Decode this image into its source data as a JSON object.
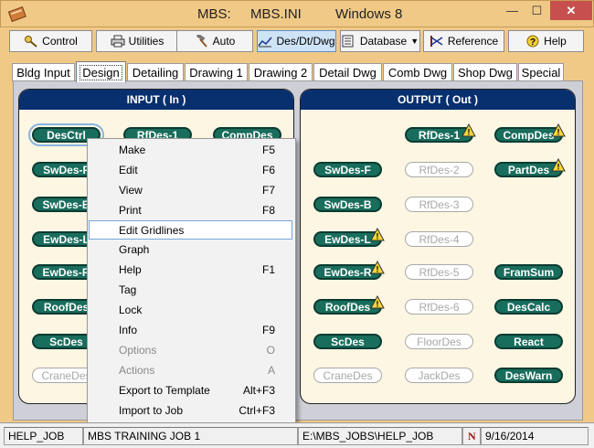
{
  "window": {
    "title_app": "MBS:",
    "title_file": "MBS.INI",
    "title_os": "Windows 8",
    "minimize": "—",
    "maximize": "☐",
    "close": "✕"
  },
  "toolbar": {
    "control": "Control",
    "utilities": "Utilities",
    "auto": "Auto",
    "desdtdwg": "Des/Dt/Dwg",
    "database": "Database",
    "reference": "Reference",
    "help": "Help"
  },
  "tabs": [
    "Bldg Input",
    "Design",
    "Detailing",
    "Drawing 1",
    "Drawing 2",
    "Detail Dwg",
    "Comb Dwg",
    "Shop Dwg",
    "Special"
  ],
  "input_panel": {
    "header": "INPUT ( In )",
    "pills": [
      "DesCtrl",
      "RfDes-1",
      "CompDes",
      "SwDes-F",
      "SwDes-B",
      "EwDes-L",
      "EwDes-R",
      "RoofDes",
      "ScDes",
      "CraneDes"
    ]
  },
  "output_panel": {
    "header": "OUTPUT ( Out )",
    "pills": [
      "RfDes-1",
      "CompDes",
      "SwDes-F",
      "RfDes-2",
      "PartDes",
      "SwDes-B",
      "RfDes-3",
      "EwDes-L",
      "RfDes-4",
      "EwDes-R",
      "RfDes-5",
      "FramSum",
      "RoofDes",
      "RfDes-6",
      "DesCalc",
      "ScDes",
      "FloorDes",
      "React",
      "CraneDes",
      "JackDes",
      "DesWarn"
    ]
  },
  "context_menu": [
    {
      "label": "Make",
      "key": "F5",
      "state": "enabled"
    },
    {
      "label": "Edit",
      "key": "F6",
      "state": "enabled"
    },
    {
      "label": "View",
      "key": "F7",
      "state": "enabled"
    },
    {
      "label": "Print",
      "key": "F8",
      "state": "enabled"
    },
    {
      "label": "Edit Gridlines",
      "key": "",
      "state": "highlighted"
    },
    {
      "label": "Graph",
      "key": "",
      "state": "enabled"
    },
    {
      "label": "Help",
      "key": "F1",
      "state": "enabled"
    },
    {
      "label": "Tag",
      "key": "",
      "state": "enabled"
    },
    {
      "label": "Lock",
      "key": "",
      "state": "enabled"
    },
    {
      "label": "Info",
      "key": "F9",
      "state": "enabled"
    },
    {
      "label": "Options",
      "key": "O",
      "state": "disabled"
    },
    {
      "label": "Actions",
      "key": "A",
      "state": "disabled"
    },
    {
      "label": "Export to Template",
      "key": "Alt+F3",
      "state": "enabled"
    },
    {
      "label": "Import to Job",
      "key": "Ctrl+F3",
      "state": "enabled"
    }
  ],
  "status": {
    "job": "HELP_JOB",
    "job_name": "MBS TRAINING JOB 1",
    "path": "E:\\MBS_JOBS\\HELP_JOB",
    "flag": "N",
    "date": "9/16/2014"
  },
  "colors": {
    "frame": "#f0c987",
    "panel_header": "#08306e",
    "pill_on": "#196d5c",
    "panel_bg": "#fcf6e3"
  },
  "icons": {
    "warning": "warning-icon",
    "control": "key-icon",
    "utilities": "printer-icon",
    "auto": "hammer-icon",
    "desdtdwg": "chart-icon",
    "database": "database-icon",
    "reference": "reference-icon",
    "help": "question-icon"
  }
}
